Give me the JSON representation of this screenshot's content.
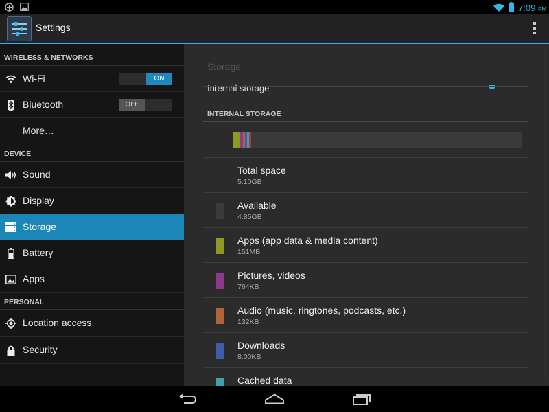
{
  "status": {
    "time": "7:09",
    "ampm": "PM"
  },
  "app": {
    "title": "Settings"
  },
  "left": {
    "sections": [
      {
        "header": "WIRELESS & NETWORKS",
        "items": [
          {
            "label": "Wi-Fi",
            "icon": "wifi-icon",
            "toggle": "ON"
          },
          {
            "label": "Bluetooth",
            "icon": "bluetooth-icon",
            "toggle": "OFF"
          },
          {
            "label": "More…",
            "icon": ""
          }
        ]
      },
      {
        "header": "DEVICE",
        "items": [
          {
            "label": "Sound",
            "icon": "sound-icon"
          },
          {
            "label": "Display",
            "icon": "display-icon"
          },
          {
            "label": "Storage",
            "icon": "storage-icon",
            "active": true
          },
          {
            "label": "Battery",
            "icon": "battery-icon"
          },
          {
            "label": "Apps",
            "icon": "apps-icon"
          }
        ]
      },
      {
        "header": "PERSONAL",
        "items": [
          {
            "label": "Location access",
            "icon": "location-icon"
          },
          {
            "label": "Security",
            "icon": "lock-icon"
          }
        ]
      }
    ]
  },
  "right": {
    "title": "Storage",
    "selected_volume": "Internal storage",
    "section_header": "INTERNAL STORAGE",
    "usage_bar": [
      {
        "name": "Apps",
        "color": "#8c9a24",
        "fraction": 0.027
      },
      {
        "name": "Pictures",
        "color": "#8b3a8d",
        "fraction": 0.008
      },
      {
        "name": "Audio",
        "color": "#b0623a",
        "fraction": 0.008
      },
      {
        "name": "Downloads",
        "color": "#3e5fa8",
        "fraction": 0.007
      },
      {
        "name": "Cached",
        "color": "#3ea0a8",
        "fraction": 0.008
      },
      {
        "name": "Misc",
        "color": "#b03a3a",
        "fraction": 0.007
      }
    ],
    "rows": [
      {
        "title": "Total space",
        "size": "5.10GB",
        "color": ""
      },
      {
        "title": "Available",
        "size": "4.85GB",
        "color": "#3a3a3a"
      },
      {
        "title": "Apps (app data & media content)",
        "size": "151MB",
        "color": "#8c9a24"
      },
      {
        "title": "Pictures, videos",
        "size": "764KB",
        "color": "#8b3a8d"
      },
      {
        "title": "Audio (music, ringtones, podcasts, etc.)",
        "size": "132KB",
        "color": "#b0623a"
      },
      {
        "title": "Downloads",
        "size": "8.00KB",
        "color": "#3e5fa8"
      },
      {
        "title": "Cached data",
        "size": "",
        "color": "#3ea0a8"
      }
    ]
  },
  "colors": {
    "accent": "#33b5e5",
    "selected": "#1b87b9"
  }
}
